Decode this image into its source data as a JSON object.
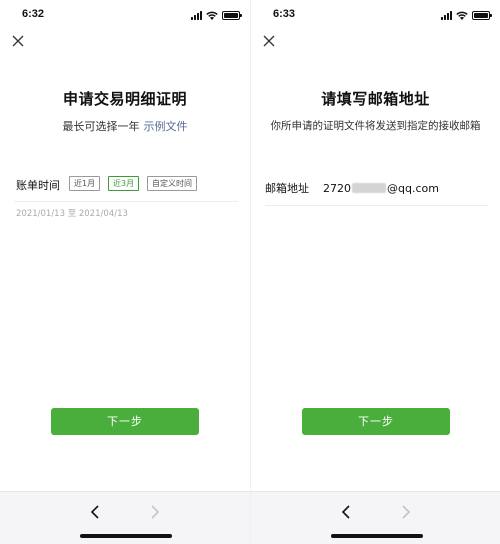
{
  "left": {
    "status_time": "6:32",
    "title": "申请交易明细证明",
    "subtitle": "最长可选择一年",
    "subtitle_link": "示例文件",
    "field_label": "账单时间",
    "chips": [
      {
        "label": "近1月",
        "selected": false
      },
      {
        "label": "近3月",
        "selected": true
      },
      {
        "label": "自定义时间",
        "selected": false
      }
    ],
    "date_range": "2021/01/13 至 2021/04/13",
    "next_button": "下一步"
  },
  "right": {
    "status_time": "6:33",
    "title": "请填写邮箱地址",
    "subtitle": "你所申请的证明文件将发送到指定的接收邮箱",
    "email_label": "邮箱地址",
    "email_prefix": "2720",
    "email_suffix": "@qq.com",
    "next_button": "下一步"
  },
  "icons": {
    "close": "close-icon",
    "back": "chevron-left-icon",
    "forward": "chevron-right-icon",
    "signal": "cellular-signal-icon",
    "wifi": "wifi-icon",
    "battery": "battery-icon"
  },
  "colors": {
    "accent_green": "#4aae3c",
    "chip_selected": "#3f9b3a",
    "link_blue": "#576b95"
  }
}
